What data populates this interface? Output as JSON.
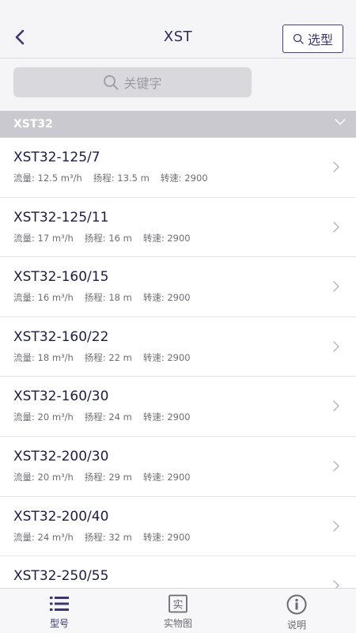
{
  "header": {
    "title": "XST",
    "select_label": "选型"
  },
  "search": {
    "placeholder": "关键字"
  },
  "group": {
    "title": "XST32"
  },
  "items": [
    {
      "name": "XST32-125/7",
      "flow": "流量: 12.5 m³/h",
      "head": "扬程: 13.5 m",
      "speed": "转速: 2900"
    },
    {
      "name": "XST32-125/11",
      "flow": "流量: 17 m³/h",
      "head": "扬程: 16 m",
      "speed": "转速: 2900"
    },
    {
      "name": "XST32-160/15",
      "flow": "流量: 16 m³/h",
      "head": "扬程: 18 m",
      "speed": "转速: 2900"
    },
    {
      "name": "XST32-160/22",
      "flow": "流量: 18 m³/h",
      "head": "扬程: 22 m",
      "speed": "转速: 2900"
    },
    {
      "name": "XST32-160/30",
      "flow": "流量: 20 m³/h",
      "head": "扬程: 24 m",
      "speed": "转速: 2900"
    },
    {
      "name": "XST32-200/30",
      "flow": "流量: 20 m³/h",
      "head": "扬程: 29 m",
      "speed": "转速: 2900"
    },
    {
      "name": "XST32-200/40",
      "flow": "流量: 24 m³/h",
      "head": "扬程: 32 m",
      "speed": "转速: 2900"
    },
    {
      "name": "XST32-250/55",
      "flow": "",
      "head": "",
      "speed": ""
    }
  ],
  "tabs": [
    {
      "label": "型号",
      "icon": "list-icon",
      "active": true
    },
    {
      "label": "实物图",
      "icon": "photo-icon",
      "active": false
    },
    {
      "label": "说明",
      "icon": "info-icon",
      "active": false
    }
  ],
  "colors": {
    "accent": "#3b3570",
    "group_bg": "#c9c9cf",
    "search_bg": "#d9d9dd"
  }
}
